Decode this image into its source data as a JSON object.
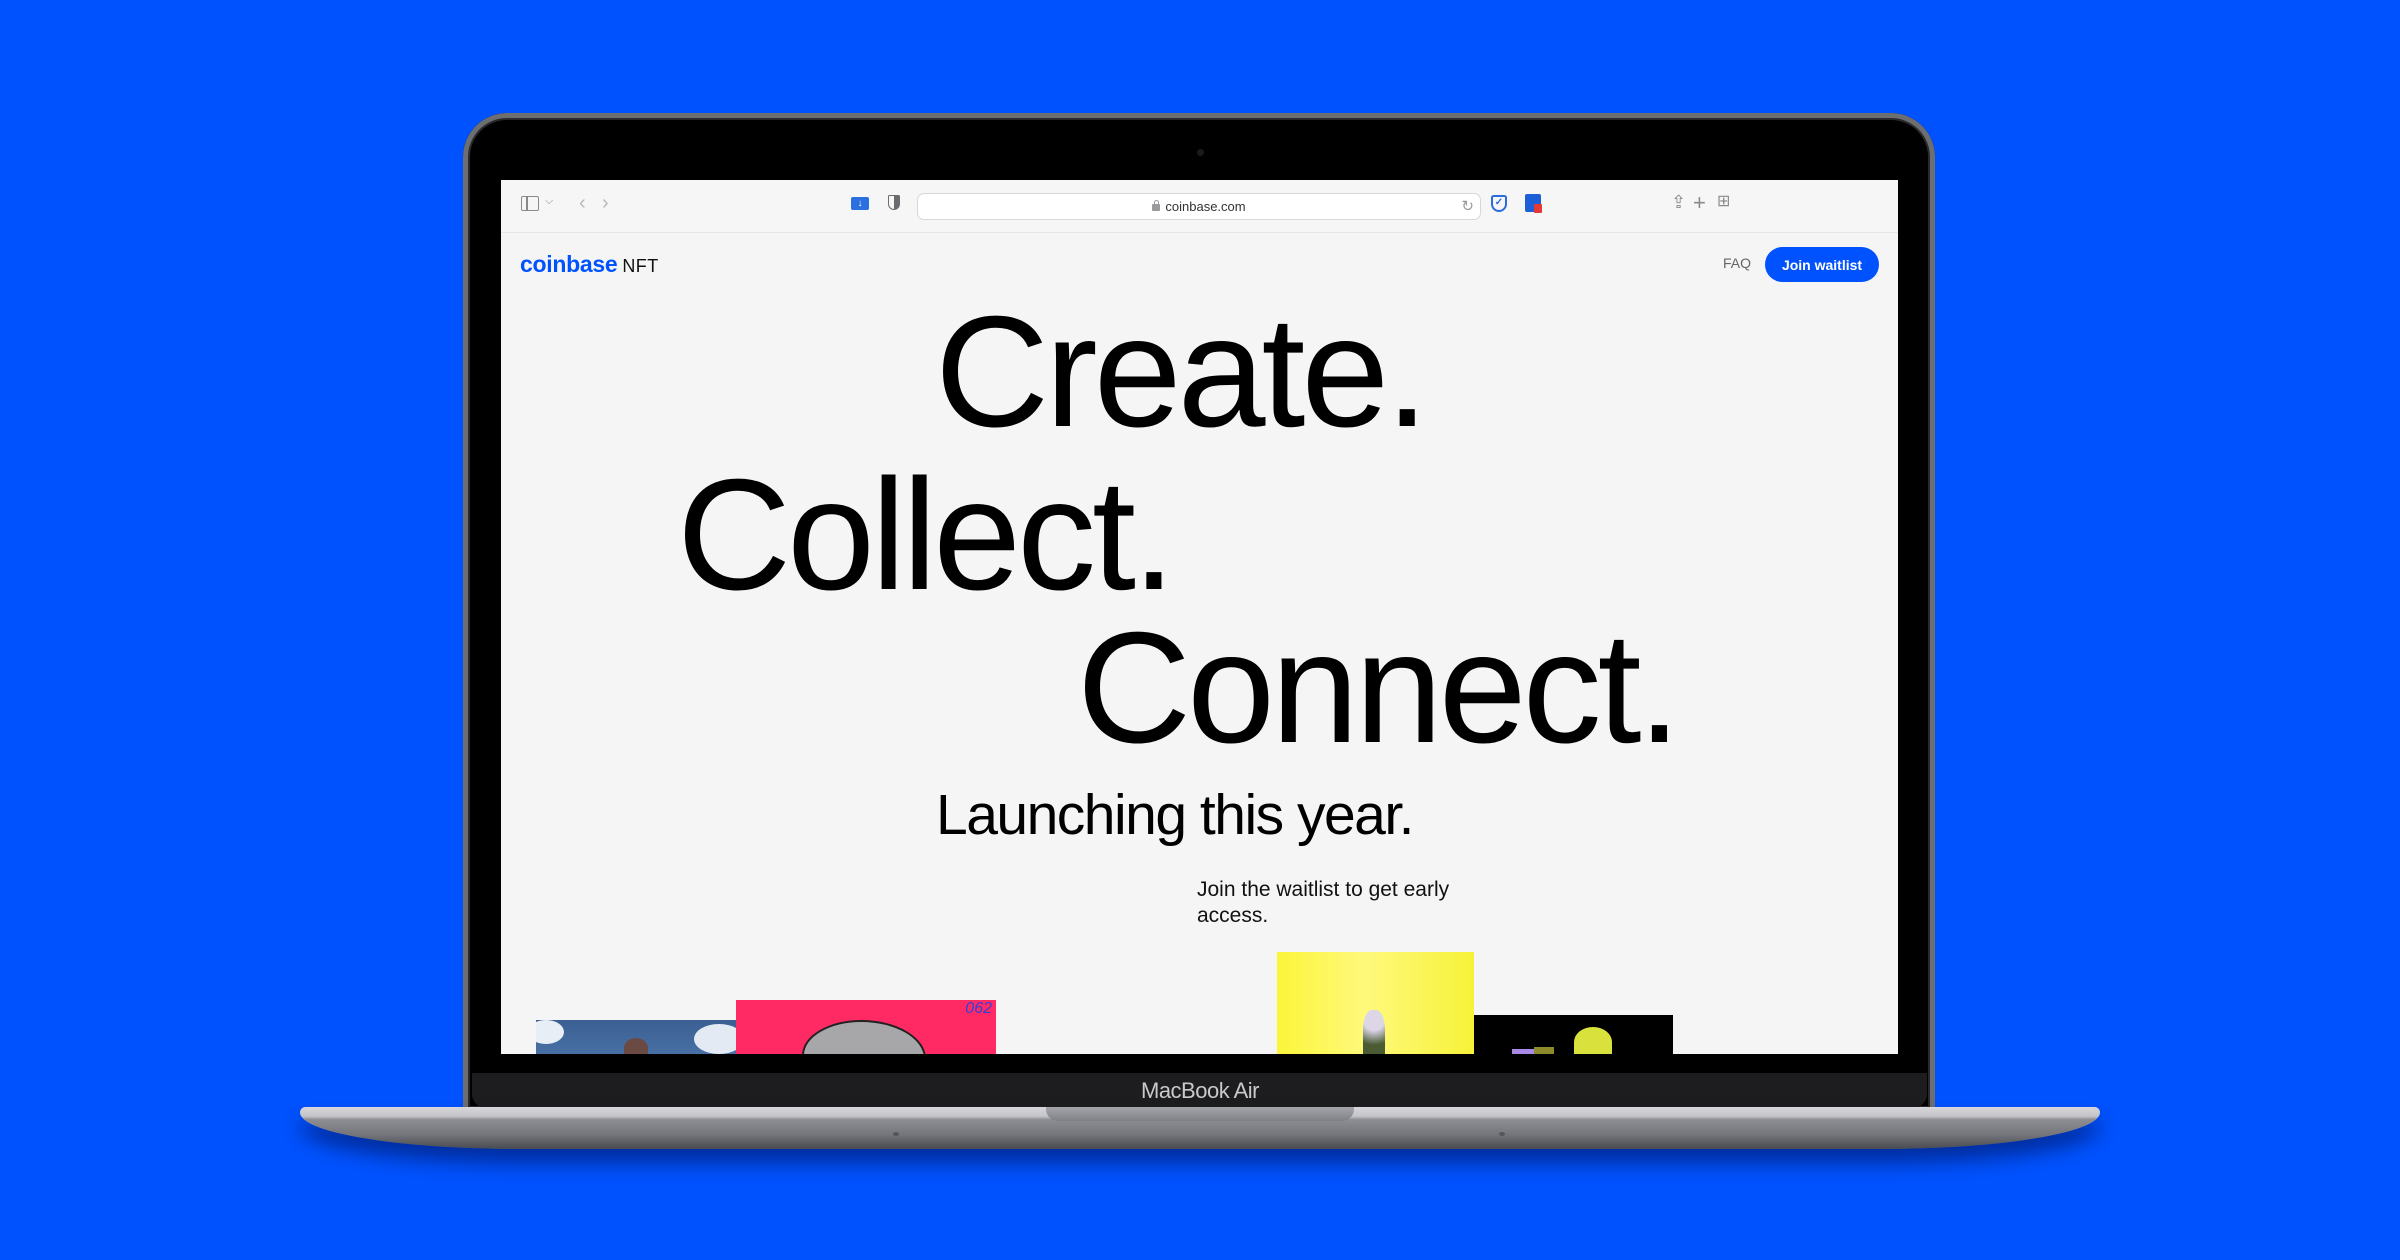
{
  "device": {
    "label": "MacBook Air",
    "background_color": "#0052ff"
  },
  "browser": {
    "url": "coinbase.com",
    "icons": {
      "sidebar": "sidebar-icon",
      "sidebar_menu": "chevron-down-icon",
      "back": "chevron-left-icon",
      "forward": "chevron-right-icon",
      "video_download_ext": "download-icon",
      "privacy_ext": "shield-icon",
      "lock": "lock-icon",
      "reload": "reload-icon",
      "adguard_ext": "shield-check-icon",
      "password_ext": "password-manager-icon",
      "share": "share-icon",
      "new_tab": "plus-icon",
      "tab_overview": "grid-icon"
    }
  },
  "page": {
    "logo": {
      "brand": "coinbase",
      "product": "NFT",
      "brand_color": "#0052ff"
    },
    "nav": {
      "faq_label": "FAQ",
      "join_label": "Join waitlist"
    },
    "hero": {
      "line1": "Create.",
      "line2": "Collect.",
      "line3": "Connect.",
      "subtitle": "Launching this year.",
      "cta_text": "Join the waitlist to get early access."
    },
    "nft_tiles": [
      {
        "name": "sky-ship-artwork",
        "color": "#3b5f92"
      },
      {
        "name": "pink-blob-artwork",
        "color": "#ff2a63",
        "label": "062"
      },
      {
        "name": "yellow-plant-artwork",
        "color": "#fbf53a"
      },
      {
        "name": "pixel-creature-artwork",
        "color": "#000000"
      }
    ]
  }
}
